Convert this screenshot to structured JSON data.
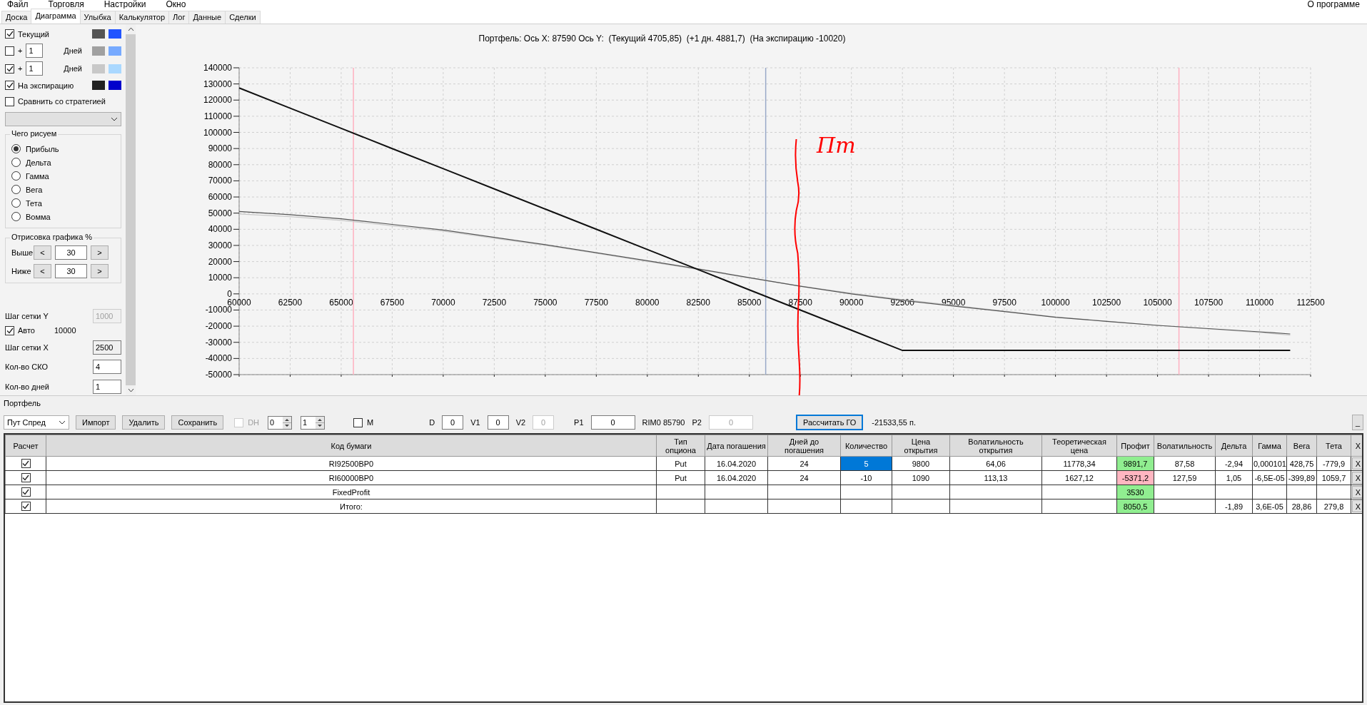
{
  "menu": {
    "items": [
      "Файл",
      "Торговля",
      "Настройки",
      "Окно"
    ],
    "right": "О программе"
  },
  "tabs": [
    {
      "label": "Доска",
      "selected": false
    },
    {
      "label": "Диаграмма",
      "selected": true
    },
    {
      "label": "Улыбка",
      "selected": false
    },
    {
      "label": "Калькулятор",
      "selected": false
    },
    {
      "label": "Лог",
      "selected": false
    },
    {
      "label": "Данные",
      "selected": false
    },
    {
      "label": "Сделки",
      "selected": false
    }
  ],
  "left_panel": {
    "series_rows": [
      {
        "kind": "named",
        "checked": true,
        "label": "Текущий",
        "swatches": [
          {
            "color": "#555555"
          },
          {
            "color": "#2255ff"
          }
        ]
      },
      {
        "kind": "days",
        "checked": false,
        "plus": "+",
        "days": "1",
        "unit": "Дней",
        "swatches": [
          {
            "color": "#a0a0a0"
          },
          {
            "color": "#77aaff"
          }
        ]
      },
      {
        "kind": "days",
        "checked": true,
        "plus": "+",
        "days": "1",
        "unit": "Дней",
        "swatches": [
          {
            "color": "#c8c8c8"
          },
          {
            "color": "#aad8ff"
          }
        ]
      },
      {
        "kind": "named",
        "checked": true,
        "label": "На экспирацию",
        "swatches": [
          {
            "color": "#222222"
          },
          {
            "color": "#0000cc"
          }
        ]
      }
    ],
    "compare": {
      "label": "Сравнить со стратегией",
      "checked": false
    },
    "draw_group": {
      "title": "Чего рисуем",
      "options": [
        {
          "label": "Прибыль",
          "selected": true
        },
        {
          "label": "Дельта",
          "selected": false
        },
        {
          "label": "Гамма",
          "selected": false
        },
        {
          "label": "Вега",
          "selected": false
        },
        {
          "label": "Тета",
          "selected": false
        },
        {
          "label": "Вомма",
          "selected": false
        }
      ]
    },
    "range_group": {
      "title": "Отрисовка графика %",
      "rows": [
        {
          "label": "Выше",
          "dec": "<",
          "value": "30",
          "inc": ">"
        },
        {
          "label": "Ниже",
          "dec": "<",
          "value": "30",
          "inc": ">"
        }
      ]
    },
    "settings": [
      {
        "kind": "field",
        "label": "Шаг сетки Y",
        "value": "1000",
        "disabled": true,
        "readonly": true
      },
      {
        "kind": "check",
        "label": "Авто",
        "checked": true,
        "value": "10000"
      },
      {
        "kind": "field",
        "label": "Шаг сетки X",
        "value": "2500",
        "disabled": false,
        "readonly": true
      },
      {
        "kind": "field",
        "label": "Кол-во СКО",
        "value": "4",
        "disabled": false,
        "readonly": false
      },
      {
        "kind": "field",
        "label": "Кол-во дней",
        "value": "1",
        "disabled": false,
        "readonly": false
      }
    ]
  },
  "chart": {
    "title": "Портфель: Ось X: 87590 Ось Y:  (Текущий 4705,85)  (+1 дн. 4881,7)  (На экспирацию -10020)",
    "chart_data": {
      "type": "line",
      "grid": true,
      "x": [
        60000,
        62500,
        65000,
        67500,
        70000,
        72500,
        75000,
        77500,
        80000,
        82500,
        85000,
        87500,
        90000,
        92500,
        95000,
        97500,
        100000,
        102500,
        105000,
        107500,
        110000,
        111500
      ],
      "series": [
        {
          "color": "#111111",
          "values": [
            127500,
            115000,
            102500,
            90000,
            77500,
            65000,
            52500,
            40000,
            27500,
            15000,
            2500,
            -10000,
            -22500,
            -35000,
            -35000,
            -35000,
            -35000,
            -35000,
            -35000,
            -35000,
            -35000,
            -35000
          ]
        },
        {
          "color": "#555555",
          "values": [
            51000,
            49000,
            46500,
            43000,
            39500,
            35000,
            30500,
            25500,
            20500,
            15500,
            10000,
            4700,
            0,
            -4000,
            -7500,
            -11000,
            -14500,
            -17000,
            -19500,
            -21500,
            -23500,
            -24800
          ]
        },
        {
          "color": "#c8c8c8",
          "values": [
            49500,
            47800,
            45500,
            42200,
            38800,
            34400,
            30000,
            25100,
            20100,
            15100,
            9800,
            4900,
            400,
            -3500,
            -7100,
            -10700,
            -14300,
            -16900,
            -19500,
            -21700,
            -23900,
            -25500
          ]
        }
      ],
      "ref_lines": [
        {
          "axis": "x",
          "value": 65600,
          "color": "#ffb0c0"
        },
        {
          "axis": "x",
          "value": 85800,
          "color": "#9aaac8"
        },
        {
          "axis": "x",
          "value": 106050,
          "color": "#ffb0c0"
        }
      ],
      "xlim": [
        60000,
        112500
      ],
      "ylim": [
        -50000,
        140000
      ],
      "xticks": [
        60000,
        62500,
        65000,
        67500,
        70000,
        72500,
        75000,
        77500,
        80000,
        82500,
        85000,
        87500,
        90000,
        92500,
        95000,
        97500,
        100000,
        102500,
        105000,
        107500,
        110000,
        112500
      ],
      "yticks": [
        140000,
        130000,
        120000,
        110000,
        100000,
        90000,
        80000,
        70000,
        60000,
        50000,
        40000,
        30000,
        20000,
        10000,
        0,
        -10000,
        -20000,
        -30000,
        -40000,
        -50000
      ],
      "annotations": [
        "Пт"
      ]
    }
  },
  "portfolio": {
    "title": "Портфель",
    "toolbar": [
      [
        {
          "kind": "select",
          "value": "Пут Спред"
        },
        {
          "kind": "button",
          "label": "Импорт",
          "focused": false
        },
        {
          "kind": "button",
          "label": "Удалить",
          "focused": false
        },
        {
          "kind": "button",
          "label": "Сохранить",
          "focused": false
        }
      ],
      [
        {
          "kind": "check",
          "label": "DH",
          "checked": false,
          "disabled": true
        },
        {
          "kind": "spin",
          "value": "0"
        },
        {
          "kind": "spin",
          "value": "1"
        }
      ],
      [
        {
          "kind": "check",
          "label": "M",
          "checked": false,
          "disabled": false
        }
      ],
      [
        {
          "kind": "label",
          "text": "D"
        },
        {
          "kind": "field",
          "value": "0",
          "disabled": false
        },
        {
          "kind": "label",
          "text": "V1"
        },
        {
          "kind": "field",
          "value": "0",
          "disabled": false
        },
        {
          "kind": "label",
          "text": "V2"
        },
        {
          "kind": "field",
          "value": "0",
          "disabled": true
        }
      ],
      [
        {
          "kind": "label",
          "text": "P1"
        },
        {
          "kind": "field",
          "value": "0",
          "disabled": false
        },
        {
          "kind": "label",
          "text": "RIM0 85790"
        },
        {
          "kind": "label",
          "text": "P2"
        },
        {
          "kind": "field",
          "value": "0",
          "disabled": true
        }
      ],
      [
        {
          "kind": "button",
          "label": "Рассчитать ГО",
          "focused": true
        },
        {
          "kind": "label",
          "text": "-21533,55 п."
        }
      ]
    ],
    "minimize": "_",
    "columns": [
      {
        "kind": "check",
        "label": "Расчет"
      },
      {
        "kind": "text",
        "label": "Код бумаги"
      },
      {
        "kind": "text",
        "label": "Тип опциона"
      },
      {
        "kind": "text",
        "label": "Дата погашения"
      },
      {
        "kind": "text",
        "label": "Дней до погашения"
      },
      {
        "kind": "qty",
        "label": "Количество"
      },
      {
        "kind": "text",
        "label": "Цена открытия"
      },
      {
        "kind": "text",
        "label": "Волатильность открытия"
      },
      {
        "kind": "text",
        "label": "Теоретическая цена"
      },
      {
        "kind": "profit",
        "label": "Профит"
      },
      {
        "kind": "text",
        "label": "Волатильность"
      },
      {
        "kind": "text",
        "label": "Дельта"
      },
      {
        "kind": "text",
        "label": "Гамма"
      },
      {
        "kind": "text",
        "label": "Вега"
      },
      {
        "kind": "text",
        "label": "Тета"
      },
      {
        "kind": "delete",
        "label": "X"
      }
    ],
    "rows": [
      {
        "checked": true,
        "selected": true,
        "color": "#90ee90",
        "cells": [
          "",
          "RI92500BP0",
          "Put",
          "16.04.2020",
          "24",
          "5",
          "9800",
          "64,06",
          "11778,34",
          "9891,7",
          "87,58",
          "-2,94",
          "0,000101",
          "428,75",
          "-779,9",
          "X"
        ]
      },
      {
        "checked": true,
        "selected": false,
        "color": "#ffb6c1",
        "cells": [
          "",
          "RI60000BP0",
          "Put",
          "16.04.2020",
          "24",
          "-10",
          "1090",
          "113,13",
          "1627,12",
          "-5371,2",
          "127,59",
          "1,05",
          "-6,5E-05",
          "-399,89",
          "1059,7",
          "X"
        ]
      },
      {
        "checked": true,
        "selected": false,
        "color": "#90ee90",
        "cells": [
          "",
          "FixedProfit",
          "",
          "",
          "",
          "",
          "",
          "",
          "",
          "3530",
          "",
          "",
          "",
          "",
          "",
          "X"
        ]
      },
      {
        "checked": true,
        "selected": false,
        "color": "#90ee90",
        "cells": [
          "",
          "Итого:",
          "",
          "",
          "",
          "",
          "",
          "",
          "",
          "8050,5",
          "",
          "-1,89",
          "3,6E-05",
          "28,86",
          "279,8",
          "X"
        ]
      }
    ]
  }
}
